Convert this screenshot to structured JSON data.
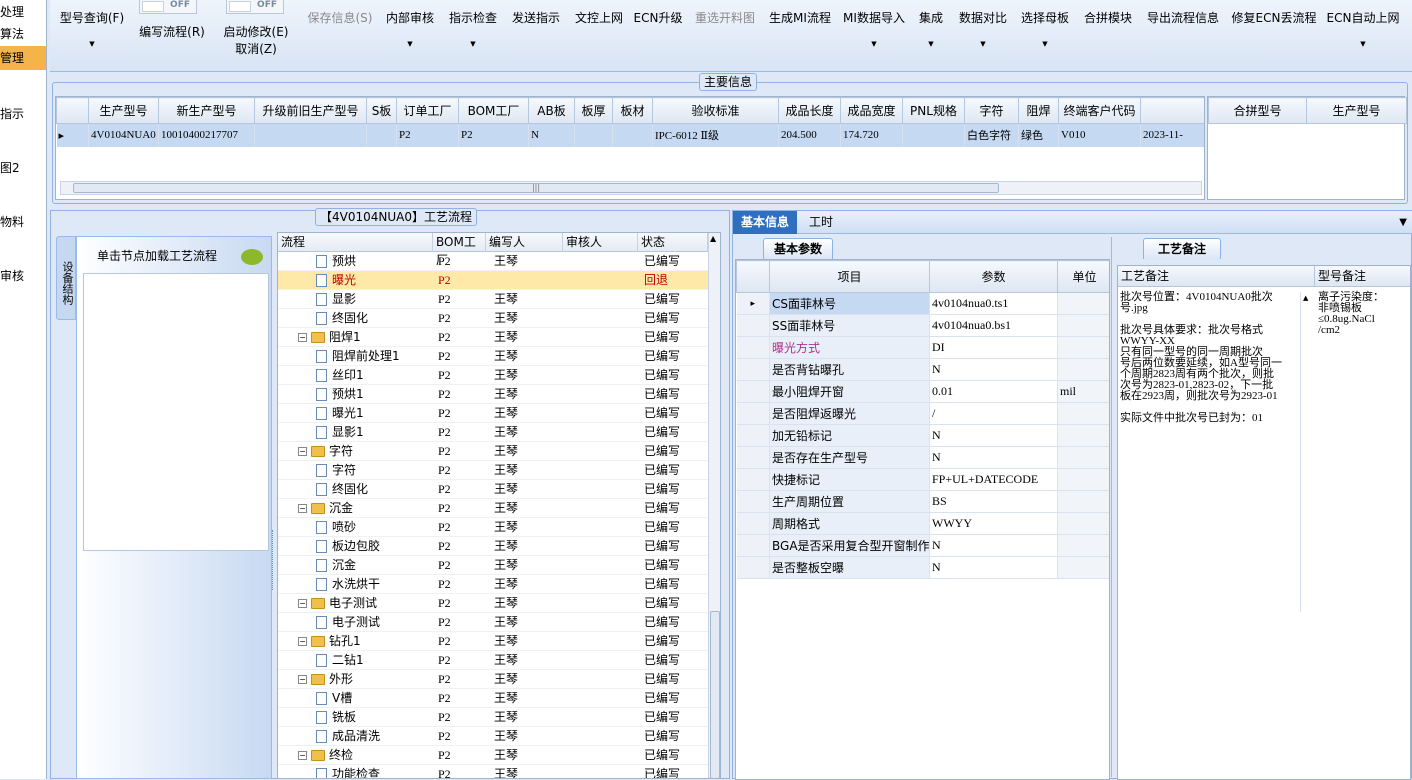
{
  "left_nav": [
    "处理",
    "算法",
    "管理",
    "指示",
    "",
    "图2",
    "",
    "物料",
    "审核"
  ],
  "toolbar": {
    "model_query": "型号查询(F)",
    "edit_flow": "编写流程(R)",
    "start_modify": "启动修改(E)",
    "cancel": "取消(Z)",
    "save_info": "保存信息(S)",
    "internal_review": "内部审核",
    "instruction_check": "指示检查",
    "send_instruction": "发送指示",
    "doc_control_upload": "文控上网",
    "ecn_upgrade": "ECN升级",
    "reselect_material_map": "重选开料图",
    "generate_mi_flow": "生成MI流程",
    "mi_data_import": "MI数据导入",
    "integration": "集成",
    "data_compare": "数据对比",
    "select_mother_board": "选择母板",
    "panel_module": "合拼模块",
    "export_flow_info": "导出流程信息",
    "fix_ecn_lost_flow": "修复ECN丢流程",
    "ecn_auto_upload": "ECN自动上网",
    "toggle_off": "OFF"
  },
  "main_info": {
    "legend": "主要信息",
    "columns": [
      "生产型号",
      "新生产型号",
      "升级前旧生产型号",
      "S板",
      "订单工厂",
      "BOM工厂",
      "AB板",
      "板厚",
      "板材",
      "验收标准",
      "成品长度",
      "成品宽度",
      "PNL规格",
      "字符",
      "阻焊",
      "终端客户代码",
      ""
    ],
    "row": [
      "4V0104NUA0",
      "10010400217707",
      "",
      "",
      "P2",
      "P2",
      "N",
      "",
      "",
      "IPC-6012 Ⅱ级",
      "204.500",
      "174.720",
      "",
      "白色字符",
      "绿色",
      "V010",
      "2023-11-"
    ],
    "side_columns": [
      "合拼型号",
      "生产型号"
    ],
    "scroll_grip": "|||"
  },
  "flow_panel": {
    "title": "【4V0104NUA0】工艺流程",
    "side_tab": "设备结构",
    "load_hint": "单击节点加载工艺流程",
    "columns": [
      "流程",
      "BOM工厂",
      "编写人",
      "审核人",
      "状态"
    ],
    "rows": [
      {
        "name": "预烘",
        "level": 2,
        "type": "doc",
        "bom": "P2",
        "writer": "王琴",
        "reviewer": "",
        "status": "已编写"
      },
      {
        "name": "曝光",
        "level": 2,
        "type": "doc",
        "bom": "P2",
        "writer": "",
        "reviewer": "",
        "status": "回退",
        "error": true
      },
      {
        "name": "显影",
        "level": 2,
        "type": "doc",
        "bom": "P2",
        "writer": "王琴",
        "reviewer": "",
        "status": "已编写"
      },
      {
        "name": "终固化",
        "level": 2,
        "type": "doc",
        "bom": "P2",
        "writer": "王琴",
        "reviewer": "",
        "status": "已编写"
      },
      {
        "name": "阻焊1",
        "level": 1,
        "type": "folder",
        "bom": "P2",
        "writer": "王琴",
        "reviewer": "",
        "status": "已编写"
      },
      {
        "name": "阻焊前处理1",
        "level": 2,
        "type": "doc",
        "bom": "P2",
        "writer": "王琴",
        "reviewer": "",
        "status": "已编写"
      },
      {
        "name": "丝印1",
        "level": 2,
        "type": "doc",
        "bom": "P2",
        "writer": "王琴",
        "reviewer": "",
        "status": "已编写"
      },
      {
        "name": "预烘1",
        "level": 2,
        "type": "doc",
        "bom": "P2",
        "writer": "王琴",
        "reviewer": "",
        "status": "已编写"
      },
      {
        "name": "曝光1",
        "level": 2,
        "type": "doc",
        "bom": "P2",
        "writer": "王琴",
        "reviewer": "",
        "status": "已编写"
      },
      {
        "name": "显影1",
        "level": 2,
        "type": "doc",
        "bom": "P2",
        "writer": "王琴",
        "reviewer": "",
        "status": "已编写"
      },
      {
        "name": "字符",
        "level": 1,
        "type": "folder",
        "bom": "P2",
        "writer": "王琴",
        "reviewer": "",
        "status": "已编写"
      },
      {
        "name": "字符",
        "level": 2,
        "type": "doc",
        "bom": "P2",
        "writer": "王琴",
        "reviewer": "",
        "status": "已编写"
      },
      {
        "name": "终固化",
        "level": 2,
        "type": "doc",
        "bom": "P2",
        "writer": "王琴",
        "reviewer": "",
        "status": "已编写"
      },
      {
        "name": "沉金",
        "level": 1,
        "type": "folder",
        "bom": "P2",
        "writer": "王琴",
        "reviewer": "",
        "status": "已编写"
      },
      {
        "name": "喷砂",
        "level": 2,
        "type": "doc",
        "bom": "P2",
        "writer": "王琴",
        "reviewer": "",
        "status": "已编写"
      },
      {
        "name": "板边包胶",
        "level": 2,
        "type": "doc",
        "bom": "P2",
        "writer": "王琴",
        "reviewer": "",
        "status": "已编写"
      },
      {
        "name": "沉金",
        "level": 2,
        "type": "doc",
        "bom": "P2",
        "writer": "王琴",
        "reviewer": "",
        "status": "已编写"
      },
      {
        "name": "水洗烘干",
        "level": 2,
        "type": "doc",
        "bom": "P2",
        "writer": "王琴",
        "reviewer": "",
        "status": "已编写"
      },
      {
        "name": "电子测试",
        "level": 1,
        "type": "folder",
        "bom": "P2",
        "writer": "王琴",
        "reviewer": "",
        "status": "已编写"
      },
      {
        "name": "电子测试",
        "level": 2,
        "type": "doc",
        "bom": "P2",
        "writer": "王琴",
        "reviewer": "",
        "status": "已编写"
      },
      {
        "name": "钻孔1",
        "level": 1,
        "type": "folder",
        "bom": "P2",
        "writer": "王琴",
        "reviewer": "",
        "status": "已编写"
      },
      {
        "name": "二钻1",
        "level": 2,
        "type": "doc",
        "bom": "P2",
        "writer": "王琴",
        "reviewer": "",
        "status": "已编写"
      },
      {
        "name": "外形",
        "level": 1,
        "type": "folder",
        "bom": "P2",
        "writer": "王琴",
        "reviewer": "",
        "status": "已编写"
      },
      {
        "name": "V槽",
        "level": 2,
        "type": "doc",
        "bom": "P2",
        "writer": "王琴",
        "reviewer": "",
        "status": "已编写"
      },
      {
        "name": "铣板",
        "level": 2,
        "type": "doc",
        "bom": "P2",
        "writer": "王琴",
        "reviewer": "",
        "status": "已编写"
      },
      {
        "name": "成品清洗",
        "level": 2,
        "type": "doc",
        "bom": "P2",
        "writer": "王琴",
        "reviewer": "",
        "status": "已编写"
      },
      {
        "name": "终检",
        "level": 1,
        "type": "folder",
        "bom": "P2",
        "writer": "王琴",
        "reviewer": "",
        "status": "已编写"
      },
      {
        "name": "功能检查",
        "level": 2,
        "type": "doc",
        "bom": "P2",
        "writer": "王琴",
        "reviewer": "",
        "status": "已编写"
      }
    ]
  },
  "right_panel": {
    "tabs": [
      "基本信息",
      "工时"
    ],
    "params_title": "基本参数",
    "param_columns": [
      "项目",
      "参数",
      "单位"
    ],
    "params": [
      {
        "item": "CS面菲林号",
        "value": "4v0104nua0.ts1",
        "unit": ""
      },
      {
        "item": "SS面菲林号",
        "value": "4v0104nua0.bs1",
        "unit": ""
      },
      {
        "item": "曝光方式",
        "value": "DI",
        "unit": "",
        "highlight": true
      },
      {
        "item": "是否背钻曝孔",
        "value": "N",
        "unit": ""
      },
      {
        "item": "最小阻焊开窗",
        "value": "0.01",
        "unit": "mil"
      },
      {
        "item": "是否阻焊返曝光",
        "value": "/",
        "unit": ""
      },
      {
        "item": "加无铅标记",
        "value": "N",
        "unit": ""
      },
      {
        "item": "是否存在生产型号",
        "value": "N",
        "unit": ""
      },
      {
        "item": "快捷标记",
        "value": "FP+UL+DATECODE",
        "unit": ""
      },
      {
        "item": "生产周期位置",
        "value": "BS",
        "unit": ""
      },
      {
        "item": "周期格式",
        "value": "WWYY",
        "unit": ""
      },
      {
        "item": "BGA是否采用复合型开窗制作",
        "value": "N",
        "unit": ""
      },
      {
        "item": "是否整板空曝",
        "value": "N",
        "unit": ""
      }
    ],
    "remarks_title": "工艺备注",
    "remarks_columns": [
      "工艺备注",
      "型号备注"
    ],
    "process_remark": [
      "批次号位置：4V0104NUA0批次",
      "号.jpg",
      "",
      "批次号具体要求：批次号格式",
      "WWYY-XX",
      "只有同一型号的同一周期批次",
      "号后两位数要延续，如A型号同一",
      "个周期2823周有两个批次，则批",
      "次号为2823-01,2823-02，下一批",
      "板在2923周，则批次号为2923-01",
      "",
      "实际文件中批次号已封为：01"
    ],
    "model_remark": [
      "离子污染度：",
      "非喷锡板",
      "≤0.8ug.NaCl",
      "/cm2"
    ]
  }
}
